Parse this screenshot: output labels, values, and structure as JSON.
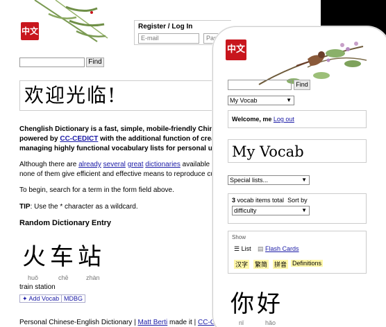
{
  "header": {
    "logo_text": "中文",
    "register_title": "Register / Log In",
    "email_placeholder": "E-mail",
    "password_placeholder": "Pas"
  },
  "search": {
    "find_label": "Find"
  },
  "desktop": {
    "welcome": "欢迎光临!",
    "intro_lines": [
      "Chenglish Dictionary is a fast, simple, mobile-friendly Chinese",
      "powered by ",
      "CC-CEDICT",
      " with the additional function of creating",
      "managing highly functional vocabulary lists for personal use a"
    ],
    "paragraph2_prefix": "Although there are ",
    "paragraph2_links": [
      "already",
      "several",
      "great",
      "dictionaries"
    ],
    "paragraph2_suffix": " available for C",
    "paragraph2_line2": "none of them give efficient and effective means to reproduce custon",
    "paragraph3": "To begin, search for a term in the form field above.",
    "tip_label": "TIP",
    "tip_text": ": Use the * character as a wildcard.",
    "random_heading": "Random Dictionary Entry",
    "entry": {
      "chars": "火车站",
      "pinyin": [
        "huǒ",
        "chē",
        "zhàn"
      ],
      "definition": "train station"
    },
    "add_vocab": "✦ Add Vocab",
    "mdbg": "MDBG",
    "footer_prefix": "Personal Chinese-English Dictionary | ",
    "footer_author": "Matt Berti",
    "footer_mid": " made it | ",
    "footer_link": "CC-CEDI"
  },
  "mobile": {
    "vocab_select": "My Vocab",
    "welcome_prefix": "Welcome, me ",
    "logout": "Log out",
    "title": "My Vocab",
    "special_lists": "Special lists...",
    "count_num": "3",
    "count_text": " vocab items total",
    "sort_by": "Sort by",
    "sort_value": "difficulty",
    "show_legend": "Show",
    "tab_list": "List",
    "tab_flash": "Flash Cards",
    "tags": [
      "汉字",
      "繁简",
      "拼音",
      "Definitions"
    ],
    "entry": {
      "chars": "你好",
      "pinyin": [
        "nǐ",
        "hǎo"
      ]
    }
  }
}
